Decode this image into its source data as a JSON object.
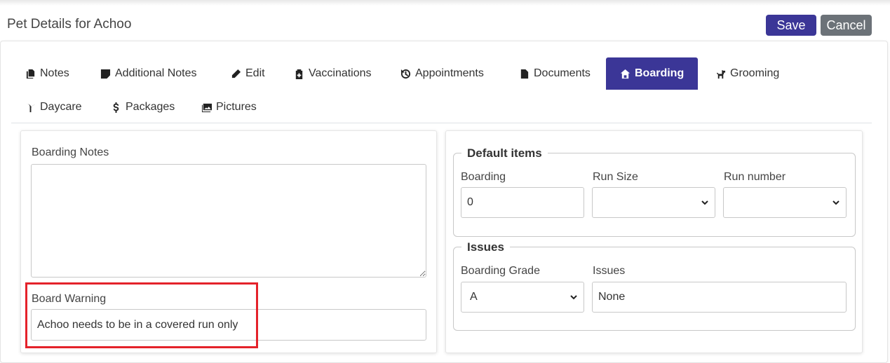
{
  "page": {
    "title": "Pet Details for Achoo"
  },
  "actions": {
    "save": "Save",
    "cancel": "Cancel"
  },
  "tabs": [
    {
      "label": "Notes",
      "icon": "copy-icon"
    },
    {
      "label": "Additional Notes",
      "icon": "sticky-note-icon"
    },
    {
      "label": "Edit",
      "icon": "pencil-icon"
    },
    {
      "label": "Vaccinations",
      "icon": "medical-clipboard-icon"
    },
    {
      "label": "Appointments",
      "icon": "history-icon"
    },
    {
      "label": "Documents",
      "icon": "file-icon"
    },
    {
      "label": "Boarding",
      "icon": "home-icon",
      "active": true
    },
    {
      "label": "Grooming",
      "icon": "dog-icon"
    },
    {
      "label": "Daycare",
      "icon": "seedling-icon"
    },
    {
      "label": "Packages",
      "icon": "dollar-icon"
    },
    {
      "label": "Pictures",
      "icon": "images-icon"
    }
  ],
  "boarding": {
    "notes_label": "Boarding Notes",
    "notes_value": "",
    "warning_label": "Board Warning",
    "warning_value": "Achoo needs to be in a covered run only"
  },
  "default_items": {
    "legend": "Default items",
    "boarding_label": "Boarding",
    "boarding_value": "0",
    "run_size_label": "Run Size",
    "run_size_value": "",
    "run_number_label": "Run number",
    "run_number_value": ""
  },
  "issues": {
    "legend": "Issues",
    "grade_label": "Boarding Grade",
    "grade_value": "A",
    "issues_label": "Issues",
    "issues_value": "None"
  },
  "colors": {
    "primary": "#3b3697",
    "secondary": "#6c7278",
    "highlight": "#e4222a"
  }
}
